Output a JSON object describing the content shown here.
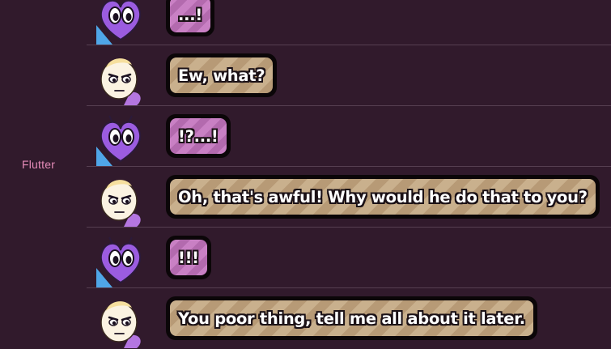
{
  "sidebar": {
    "speaker_label": "Flutter"
  },
  "chat": {
    "rows": [
      {
        "speaker": "purple-heart",
        "text": "...!"
      },
      {
        "speaker": "cream-pony",
        "text": "Ew, what?"
      },
      {
        "speaker": "purple-heart",
        "text": "!?...!"
      },
      {
        "speaker": "cream-pony",
        "text": "Oh, that's awful! Why would he do that to you?"
      },
      {
        "speaker": "purple-heart",
        "text": "!!!"
      },
      {
        "speaker": "cream-pony",
        "text": "You poor thing, tell me all about it later."
      }
    ]
  },
  "colors": {
    "background": "#311a2c",
    "label": "#e58bb8",
    "purple_bubble": "#c980c4",
    "tan_bubble": "#c9b08d",
    "bubble_border": "#0b0608"
  }
}
